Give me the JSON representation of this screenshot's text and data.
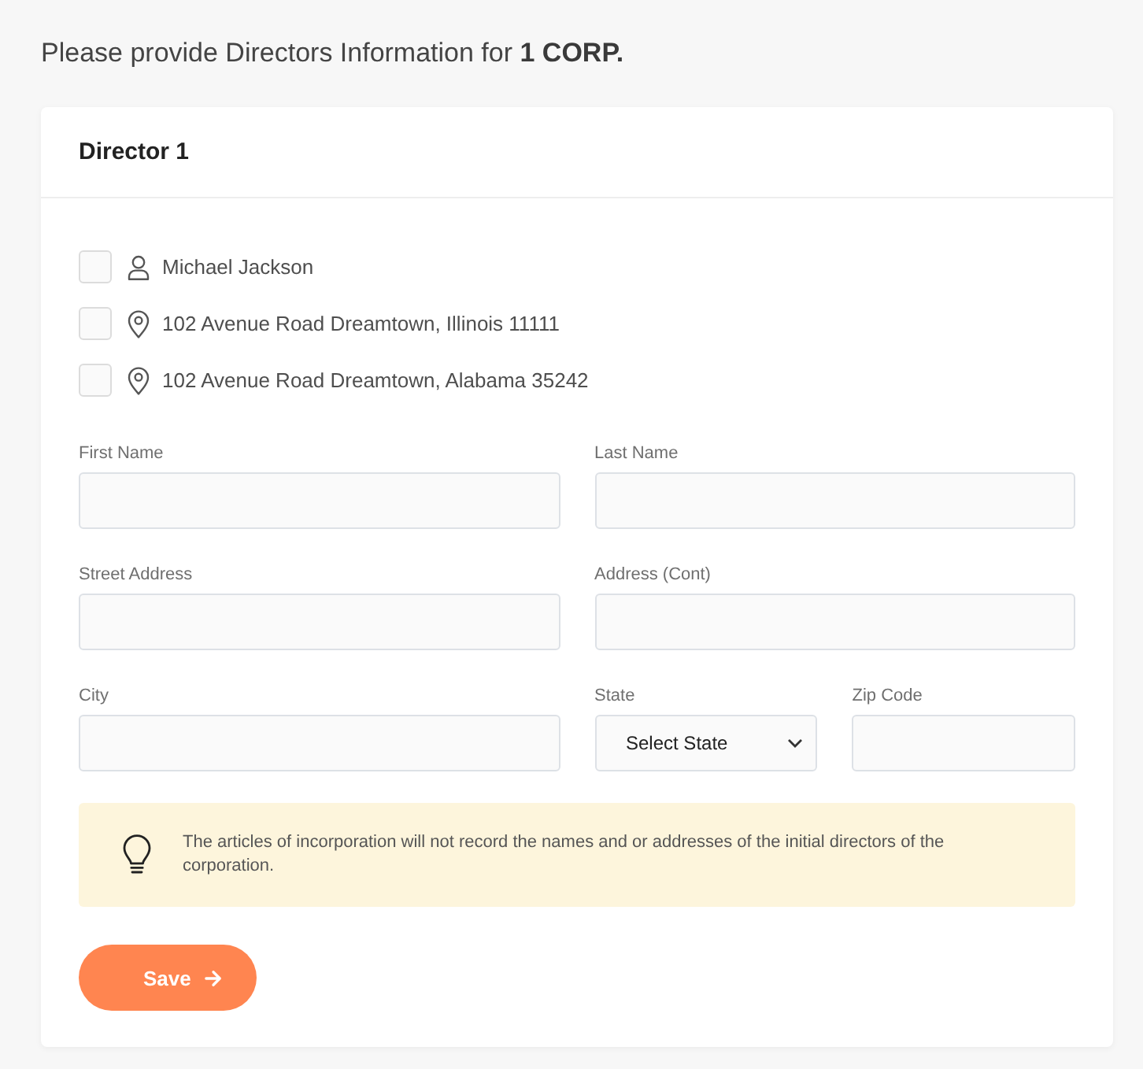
{
  "heading": {
    "text": "Please provide Directors Information for **1 CORP.**"
  },
  "director": {
    "title": "Director 1",
    "suggestions": [
      {
        "kind": "person",
        "label": "Michael Jackson",
        "checked": false
      },
      {
        "kind": "address",
        "label": "102 Avenue Road Dreamtown, Illinois 11111",
        "checked": false
      },
      {
        "kind": "address",
        "label": "102 Avenue Road Dreamtown, Alabama 35242",
        "checked": false
      }
    ],
    "field_rows": [
      {
        "fields": [
          {
            "kind": "text",
            "label": "First Name"
          },
          {
            "kind": "text",
            "label": "Last Name"
          }
        ]
      },
      {
        "fields": [
          {
            "kind": "text",
            "label": "Street Address"
          },
          {
            "kind": "text",
            "label": "Address (Cont)"
          }
        ]
      },
      {
        "fields": [
          {
            "kind": "text",
            "label": "City"
          },
          {
            "kind": "select",
            "label": "State",
            "value": "Select State"
          },
          {
            "kind": "text",
            "label": "Zip Code"
          }
        ]
      }
    ],
    "note": {
      "text": "The articles of incorporation will not record the names and or addresses of the initial directors of the corporation."
    },
    "save_button": {
      "label": "Save"
    }
  }
}
